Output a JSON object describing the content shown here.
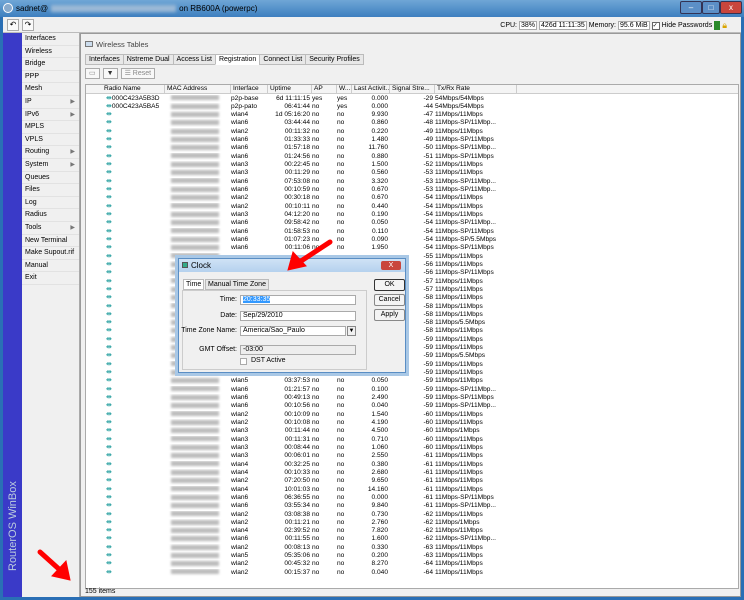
{
  "title": {
    "user": "sadnet@",
    "suffix": "on RB600A (powerpc)"
  },
  "status": {
    "cpu_label": "CPU:",
    "cpu": "38%",
    "uptime": "426d 11:11:35",
    "memory_label": "Memory:",
    "memory": "95.6 MiB",
    "hide_passwords": "Hide Passwords"
  },
  "brand": "RouterOS WinBox",
  "menu": [
    {
      "label": "Interfaces"
    },
    {
      "label": "Wireless"
    },
    {
      "label": "Bridge"
    },
    {
      "label": "PPP"
    },
    {
      "label": "Mesh"
    },
    {
      "label": "IP",
      "sub": true
    },
    {
      "label": "IPv6",
      "sub": true
    },
    {
      "label": "MPLS"
    },
    {
      "label": "VPLS"
    },
    {
      "label": "Routing",
      "sub": true
    },
    {
      "label": "System",
      "sub": true
    },
    {
      "label": "Queues"
    },
    {
      "label": "Files"
    },
    {
      "label": "Log"
    },
    {
      "label": "Radius"
    },
    {
      "label": "Tools",
      "sub": true
    },
    {
      "label": "New Terminal"
    },
    {
      "label": "Make Supout.rif"
    },
    {
      "label": "Manual"
    },
    {
      "label": "Exit"
    }
  ],
  "window": {
    "title": "Wireless Tables",
    "tabs": [
      "Interfaces",
      "Nstreme Dual",
      "Access List",
      "Registration",
      "Connect List",
      "Security Profiles"
    ],
    "active_tab": 3,
    "reset": "Reset",
    "status": "155 items"
  },
  "columns": [
    "Radio Name",
    "MAC Address",
    "Interface",
    "Uptime",
    "AP",
    "W...",
    "Last Activit...",
    "Signal Stre...",
    "Tx/Rx Rate"
  ],
  "rows": [
    [
      "000C423A5B3D",
      "p2p-base",
      "6d 11:11:15",
      "yes",
      "yes",
      "0.000",
      "-29",
      "54Mbps/54Mbps"
    ],
    [
      "000C423A5BA5",
      "p2p-pato",
      "06:41:44",
      "no",
      "yes",
      "0.000",
      "-44",
      "54Mbps/54Mbps"
    ],
    [
      "",
      "wlan4",
      "1d 05:16:20",
      "no",
      "no",
      "9.930",
      "-47",
      "11Mbps/11Mbps"
    ],
    [
      "",
      "wlan6",
      "03:44:44",
      "no",
      "no",
      "0.860",
      "-48",
      "11Mbps-SP/11Mbp..."
    ],
    [
      "",
      "wlan2",
      "00:11:32",
      "no",
      "no",
      "0.220",
      "-49",
      "11Mbps/11Mbps"
    ],
    [
      "",
      "wlan6",
      "01:33:33",
      "no",
      "no",
      "1.480",
      "-49",
      "11Mbps-SP/11Mbps"
    ],
    [
      "",
      "wlan6",
      "01:57:18",
      "no",
      "no",
      "11.760",
      "-50",
      "11Mbps-SP/11Mbp..."
    ],
    [
      "",
      "wlan6",
      "01:24:56",
      "no",
      "no",
      "0.880",
      "-51",
      "11Mbps-SP/11Mbps"
    ],
    [
      "",
      "wlan3",
      "00:22:45",
      "no",
      "no",
      "1.500",
      "-52",
      "11Mbps/11Mbps"
    ],
    [
      "",
      "wlan3",
      "00:11:29",
      "no",
      "no",
      "0.560",
      "-53",
      "11Mbps/11Mbps"
    ],
    [
      "",
      "wlan6",
      "07:53:08",
      "no",
      "no",
      "3.320",
      "-53",
      "11Mbps-SP/11Mbp..."
    ],
    [
      "",
      "wlan6",
      "00:10:59",
      "no",
      "no",
      "0.670",
      "-53",
      "11Mbps-SP/11Mbp..."
    ],
    [
      "",
      "wlan2",
      "00:30:18",
      "no",
      "no",
      "0.670",
      "-54",
      "11Mbps/11Mbps"
    ],
    [
      "",
      "wlan2",
      "00:10:11",
      "no",
      "no",
      "0.440",
      "-54",
      "11Mbps/11Mbps"
    ],
    [
      "",
      "wlan3",
      "04:12:20",
      "no",
      "no",
      "0.190",
      "-54",
      "11Mbps/11Mbps"
    ],
    [
      "",
      "wlan6",
      "09:58:42",
      "no",
      "no",
      "0.050",
      "-54",
      "11Mbps-SP/11Mbp..."
    ],
    [
      "",
      "wlan6",
      "01:58:53",
      "no",
      "no",
      "0.110",
      "-54",
      "11Mbps-SP/11Mbps"
    ],
    [
      "",
      "wlan6",
      "01:07:23",
      "no",
      "no",
      "0.090",
      "-54",
      "11Mbps-SP/5.5Mbps"
    ],
    [
      "",
      "wlan6",
      "00:11:06",
      "no",
      "no",
      "1.950",
      "-54",
      "11Mbps-SP/11Mbps"
    ],
    [
      "",
      "",
      "",
      "",
      "",
      "",
      "-55",
      "11Mbps/11Mbps"
    ],
    [
      "",
      "",
      "",
      "",
      "",
      "",
      "-56",
      "11Mbps/11Mbps"
    ],
    [
      "",
      "",
      "",
      "",
      "",
      "",
      "-56",
      "11Mbps-SP/11Mbps"
    ],
    [
      "",
      "",
      "",
      "",
      "",
      "",
      "-57",
      "11Mbps/11Mbps"
    ],
    [
      "",
      "",
      "",
      "",
      "",
      "",
      "-57",
      "11Mbps/11Mbps"
    ],
    [
      "",
      "",
      "",
      "",
      "",
      "",
      "-58",
      "11Mbps/11Mbps"
    ],
    [
      "",
      "",
      "",
      "",
      "",
      "",
      "-58",
      "11Mbps/11Mbps"
    ],
    [
      "",
      "",
      "",
      "",
      "",
      "",
      "-58",
      "11Mbps/11Mbps"
    ],
    [
      "",
      "",
      "",
      "",
      "",
      "",
      "-58",
      "11Mbps/5.5Mbps"
    ],
    [
      "",
      "",
      "",
      "",
      "",
      "",
      "-58",
      "11Mbps/11Mbps"
    ],
    [
      "",
      "",
      "",
      "",
      "",
      "",
      "-59",
      "11Mbps/11Mbps"
    ],
    [
      "",
      "",
      "",
      "",
      "",
      "",
      "-59",
      "11Mbps/11Mbps"
    ],
    [
      "",
      "",
      "",
      "",
      "",
      "",
      "-59",
      "11Mbps/5.5Mbps"
    ],
    [
      "",
      "",
      "",
      "",
      "",
      "",
      "-59",
      "11Mbps/11Mbps"
    ],
    [
      "",
      "",
      "",
      "",
      "",
      "",
      "-59",
      "11Mbps/11Mbps"
    ],
    [
      "",
      "wlan5",
      "03:37:53",
      "no",
      "no",
      "0.050",
      "-59",
      "11Mbps/11Mbps"
    ],
    [
      "",
      "wlan6",
      "01:21:57",
      "no",
      "no",
      "0.100",
      "-59",
      "11Mbps-SP/11Mbp..."
    ],
    [
      "",
      "wlan6",
      "00:49:13",
      "no",
      "no",
      "2.490",
      "-59",
      "11Mbps-SP/11Mbps"
    ],
    [
      "",
      "wlan6",
      "00:10:56",
      "no",
      "no",
      "0.040",
      "-59",
      "11Mbps-SP/11Mbp..."
    ],
    [
      "",
      "wlan2",
      "00:10:09",
      "no",
      "no",
      "1.540",
      "-60",
      "11Mbps/11Mbps"
    ],
    [
      "",
      "wlan2",
      "00:10:08",
      "no",
      "no",
      "4.190",
      "-60",
      "11Mbps/11Mbps"
    ],
    [
      "",
      "wlan3",
      "00:11:44",
      "no",
      "no",
      "4.500",
      "-60",
      "11Mbps/1Mbps"
    ],
    [
      "",
      "wlan3",
      "00:11:31",
      "no",
      "no",
      "0.710",
      "-60",
      "11Mbps/11Mbps"
    ],
    [
      "",
      "wlan3",
      "00:08:44",
      "no",
      "no",
      "1.060",
      "-60",
      "11Mbps/11Mbps"
    ],
    [
      "",
      "wlan3",
      "00:06:01",
      "no",
      "no",
      "2.550",
      "-61",
      "11Mbps/11Mbps"
    ],
    [
      "",
      "wlan4",
      "00:32:25",
      "no",
      "no",
      "0.380",
      "-61",
      "11Mbps/11Mbps"
    ],
    [
      "",
      "wlan4",
      "00:10:33",
      "no",
      "no",
      "2.680",
      "-61",
      "11Mbps/11Mbps"
    ],
    [
      "",
      "wlan2",
      "07:20:50",
      "no",
      "no",
      "9.650",
      "-61",
      "11Mbps/11Mbps"
    ],
    [
      "",
      "wlan4",
      "10:01:03",
      "no",
      "no",
      "14.160",
      "-61",
      "11Mbps/11Mbps"
    ],
    [
      "",
      "wlan6",
      "06:36:55",
      "no",
      "no",
      "0.000",
      "-61",
      "11Mbps-SP/11Mbps"
    ],
    [
      "",
      "wlan6",
      "03:55:34",
      "no",
      "no",
      "9.840",
      "-61",
      "11Mbps-SP/11Mbp..."
    ],
    [
      "",
      "wlan2",
      "03:08:38",
      "no",
      "no",
      "0.730",
      "-62",
      "11Mbps/11Mbps"
    ],
    [
      "",
      "wlan2",
      "00:11:21",
      "no",
      "no",
      "2.760",
      "-62",
      "11Mbps/1Mbps"
    ],
    [
      "",
      "wlan4",
      "02:39:52",
      "no",
      "no",
      "7.820",
      "-62",
      "11Mbps/11Mbps"
    ],
    [
      "",
      "wlan6",
      "00:11:55",
      "no",
      "no",
      "1.600",
      "-62",
      "11Mbps-SP/11Mbp..."
    ],
    [
      "",
      "wlan2",
      "00:08:13",
      "no",
      "no",
      "0.330",
      "-63",
      "11Mbps/11Mbps"
    ],
    [
      "",
      "wlan5",
      "05:35:06",
      "no",
      "no",
      "0.200",
      "-63",
      "11Mbps/11Mbps"
    ],
    [
      "",
      "wlan2",
      "00:45:32",
      "no",
      "no",
      "8.270",
      "-64",
      "11Mbps/11Mbps"
    ],
    [
      "",
      "wlan2",
      "00:15:37",
      "no",
      "no",
      "0.040",
      "-64",
      "11Mbps/11Mbps"
    ]
  ],
  "clock": {
    "title": "Clock",
    "tabs": [
      "Time",
      "Manual Time Zone"
    ],
    "time_label": "Time:",
    "time": "20:33:35",
    "date_label": "Date:",
    "date": "Sep/29/2010",
    "tz_label": "Time Zone Name:",
    "tz": "America/Sao_Paulo",
    "gmt_label": "GMT Offset:",
    "gmt": "-03:00",
    "dst": "DST Active",
    "ok": "OK",
    "cancel": "Cancel",
    "apply": "Apply",
    "close": "X"
  },
  "colors": {
    "accent": "#3a3ac8",
    "arrow": "#ff0000"
  }
}
